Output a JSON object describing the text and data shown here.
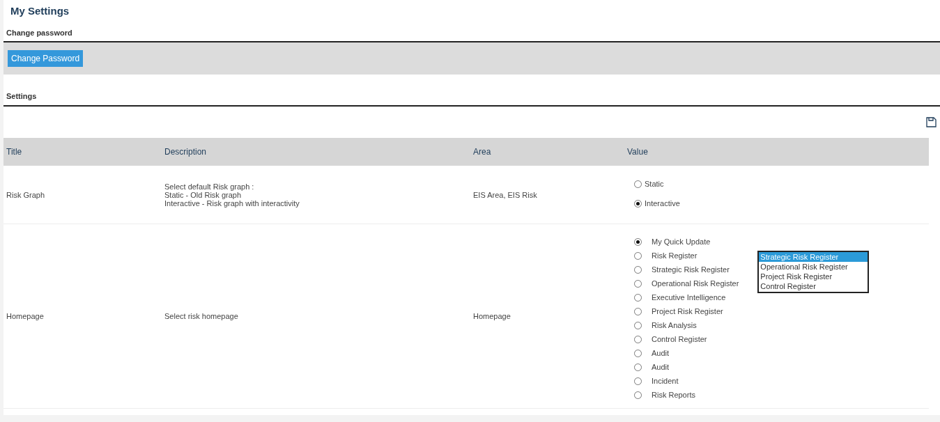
{
  "page_title": "My Settings",
  "password_section": {
    "title": "Change password",
    "button": "Change Password"
  },
  "settings_section": {
    "title": "Settings"
  },
  "table": {
    "columns": [
      "Title",
      "Description",
      "Area",
      "Value"
    ],
    "rows": [
      {
        "title": "Risk Graph",
        "description": [
          "Select default Risk graph :",
          "Static - Old Risk graph",
          "Interactive - Risk graph with interactivity"
        ],
        "area": "EIS Area, EIS Risk",
        "options": [
          {
            "label": "Static",
            "selected": false
          },
          {
            "label": "Interactive",
            "selected": true
          }
        ],
        "kind": "compact"
      },
      {
        "title": "Homepage",
        "description": [
          "Select risk homepage"
        ],
        "area": "Homepage",
        "options": [
          {
            "label": "My Quick Update",
            "selected": true
          },
          {
            "label": "Risk Register",
            "selected": false
          },
          {
            "label": "Strategic Risk Register",
            "selected": false
          },
          {
            "label": "Operational Risk Register",
            "selected": false
          },
          {
            "label": "Executive Intelligence",
            "selected": false
          },
          {
            "label": "Project Risk Register",
            "selected": false
          },
          {
            "label": "Risk Analysis",
            "selected": false
          },
          {
            "label": "Control Register",
            "selected": false
          },
          {
            "label": "Audit",
            "selected": false
          },
          {
            "label": "Audit",
            "selected": false
          },
          {
            "label": "Incident",
            "selected": false
          },
          {
            "label": "Risk Reports",
            "selected": false
          }
        ],
        "kind": "spaced",
        "listbox": [
          {
            "label": "Strategic Risk Register",
            "selected": true
          },
          {
            "label": "Operational Risk Register",
            "selected": false
          },
          {
            "label": "Project Risk Register",
            "selected": false
          },
          {
            "label": "Control Register",
            "selected": false
          }
        ]
      }
    ]
  }
}
